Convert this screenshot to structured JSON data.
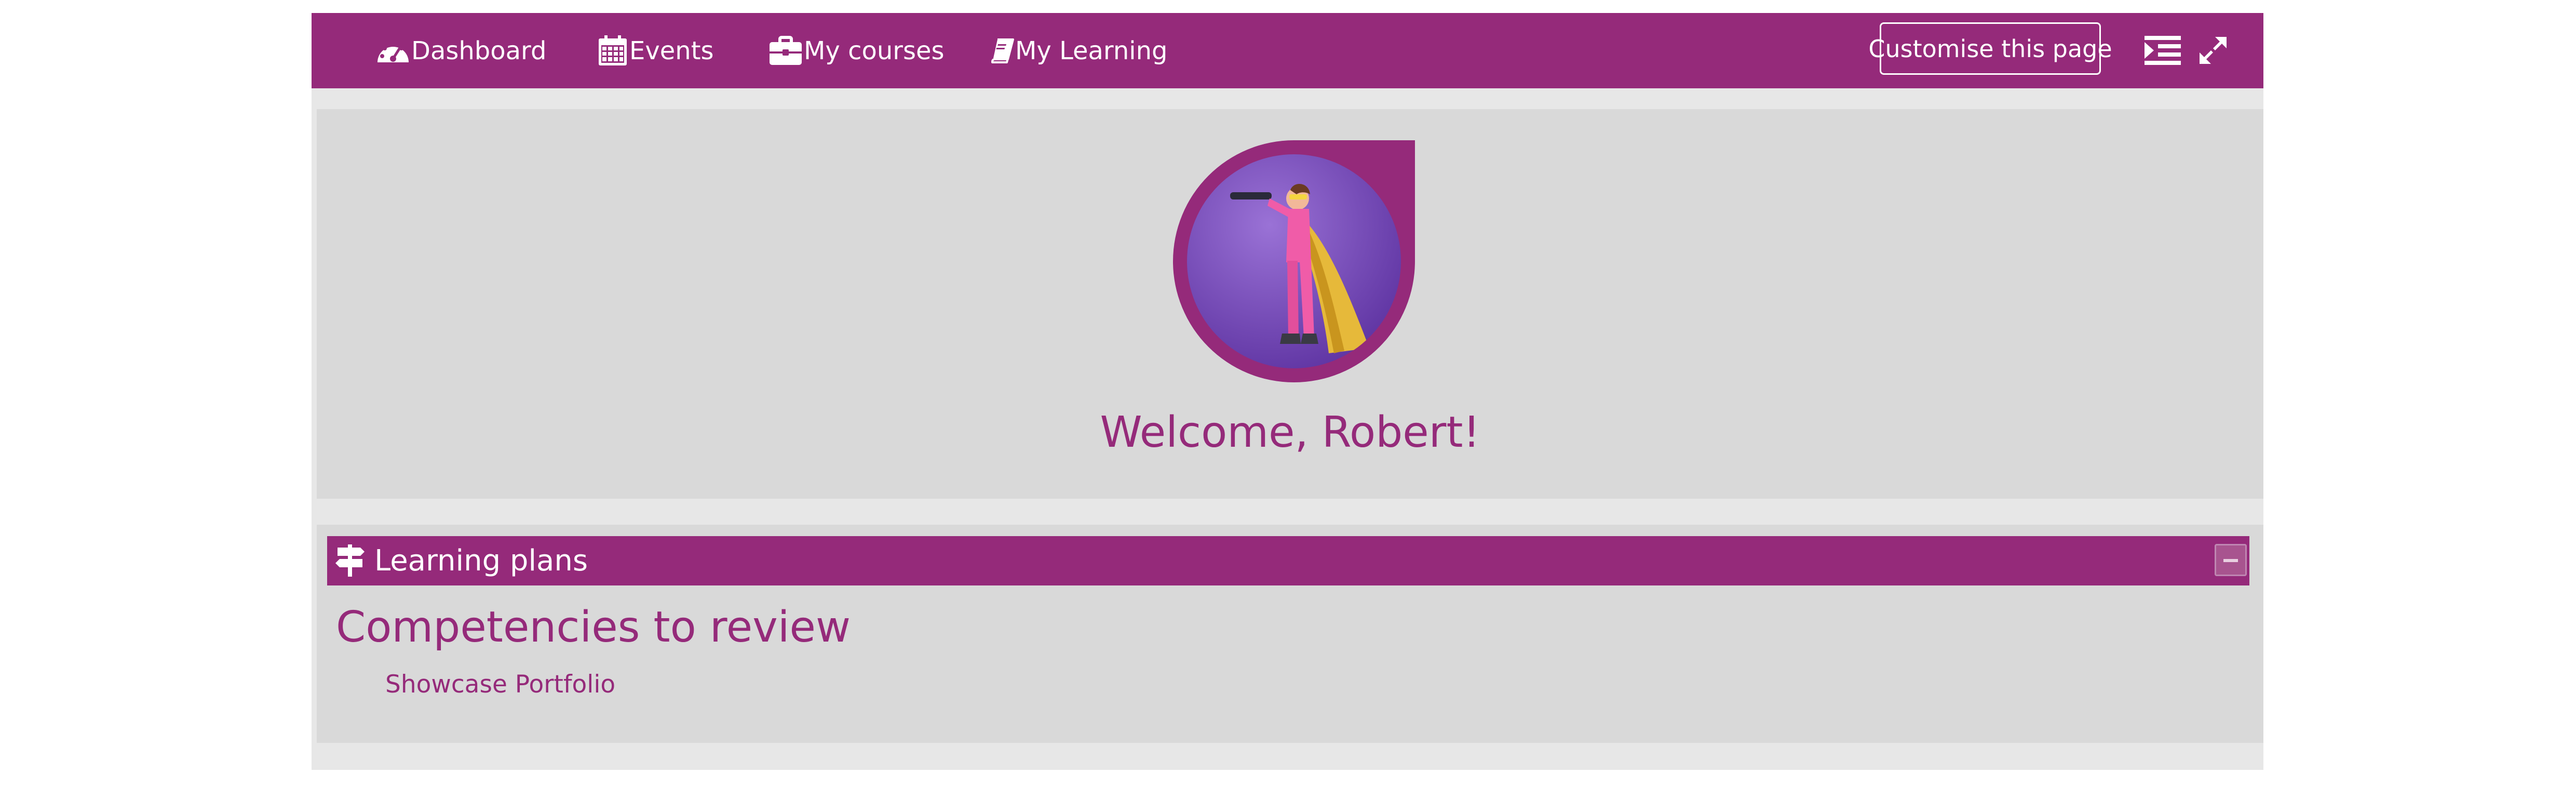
{
  "navbar": {
    "items": [
      {
        "label": "Dashboard",
        "icon": "dashboard-icon"
      },
      {
        "label": "Events",
        "icon": "calendar-icon"
      },
      {
        "label": "My courses",
        "icon": "briefcase-icon"
      },
      {
        "label": "My Learning",
        "icon": "book-icon"
      }
    ],
    "customise_label": "Customise this page",
    "indent_icon": "indent-icon",
    "expand_icon": "expand-icon"
  },
  "welcome": {
    "message": "Welcome, Robert!",
    "avatar_icon": "avatar"
  },
  "learning_plans": {
    "title": "Learning plans",
    "icon": "signpost-icon",
    "collapse_icon": "collapse-icon",
    "heading": "Competencies to review",
    "plans": [
      "Showcase Portfolio"
    ]
  },
  "colors": {
    "brand": "#952a7a",
    "panel_bg": "#d9d9d9",
    "page_bg": "#e7e7e7"
  }
}
